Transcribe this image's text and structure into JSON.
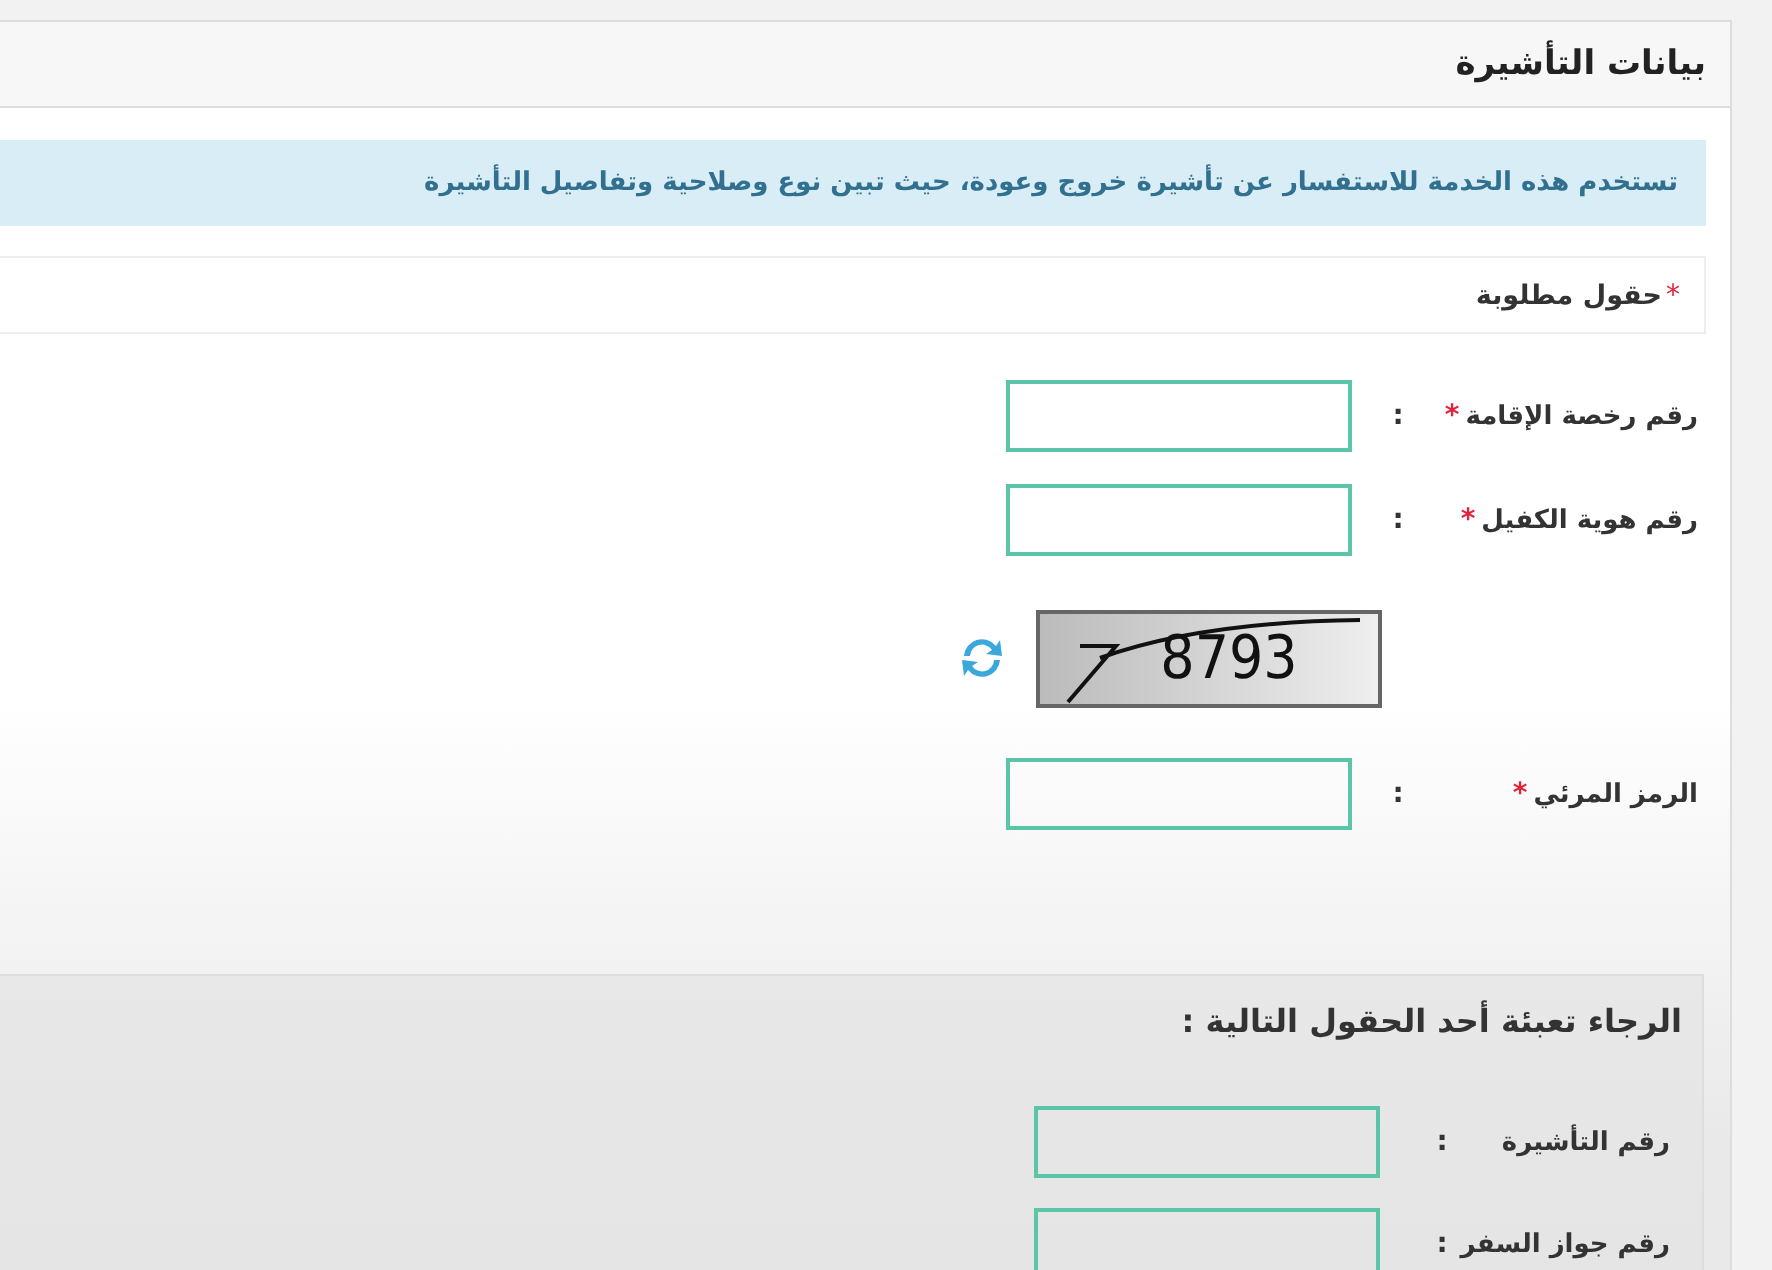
{
  "panel_title": "بيانات التأشيرة",
  "info_message": "تستخدم هذه الخدمة للاستفسار عن تأشيرة خروج وعودة، حيث تبين نوع وصلاحية وتفاصيل التأشيرة",
  "required_mark": "*",
  "required_note": "حقول مطلوبة",
  "fields": [
    {
      "kind": "input",
      "label": "رقم رخصة الإقامة",
      "required": true,
      "separator": ":"
    },
    {
      "kind": "input",
      "label": "رقم هوية الكفيل",
      "required": true,
      "separator": ":"
    },
    {
      "kind": "captcha",
      "code": "8793"
    },
    {
      "kind": "input",
      "label": "الرمز المرئي",
      "required": true,
      "separator": ":"
    }
  ],
  "optional_section": {
    "title": "الرجاء تعبئة أحد الحقول التالية :",
    "fields": [
      {
        "label": "رقم التأشيرة",
        "separator": ":"
      },
      {
        "label": "رقم جواز السفر",
        "separator": ":"
      }
    ]
  }
}
